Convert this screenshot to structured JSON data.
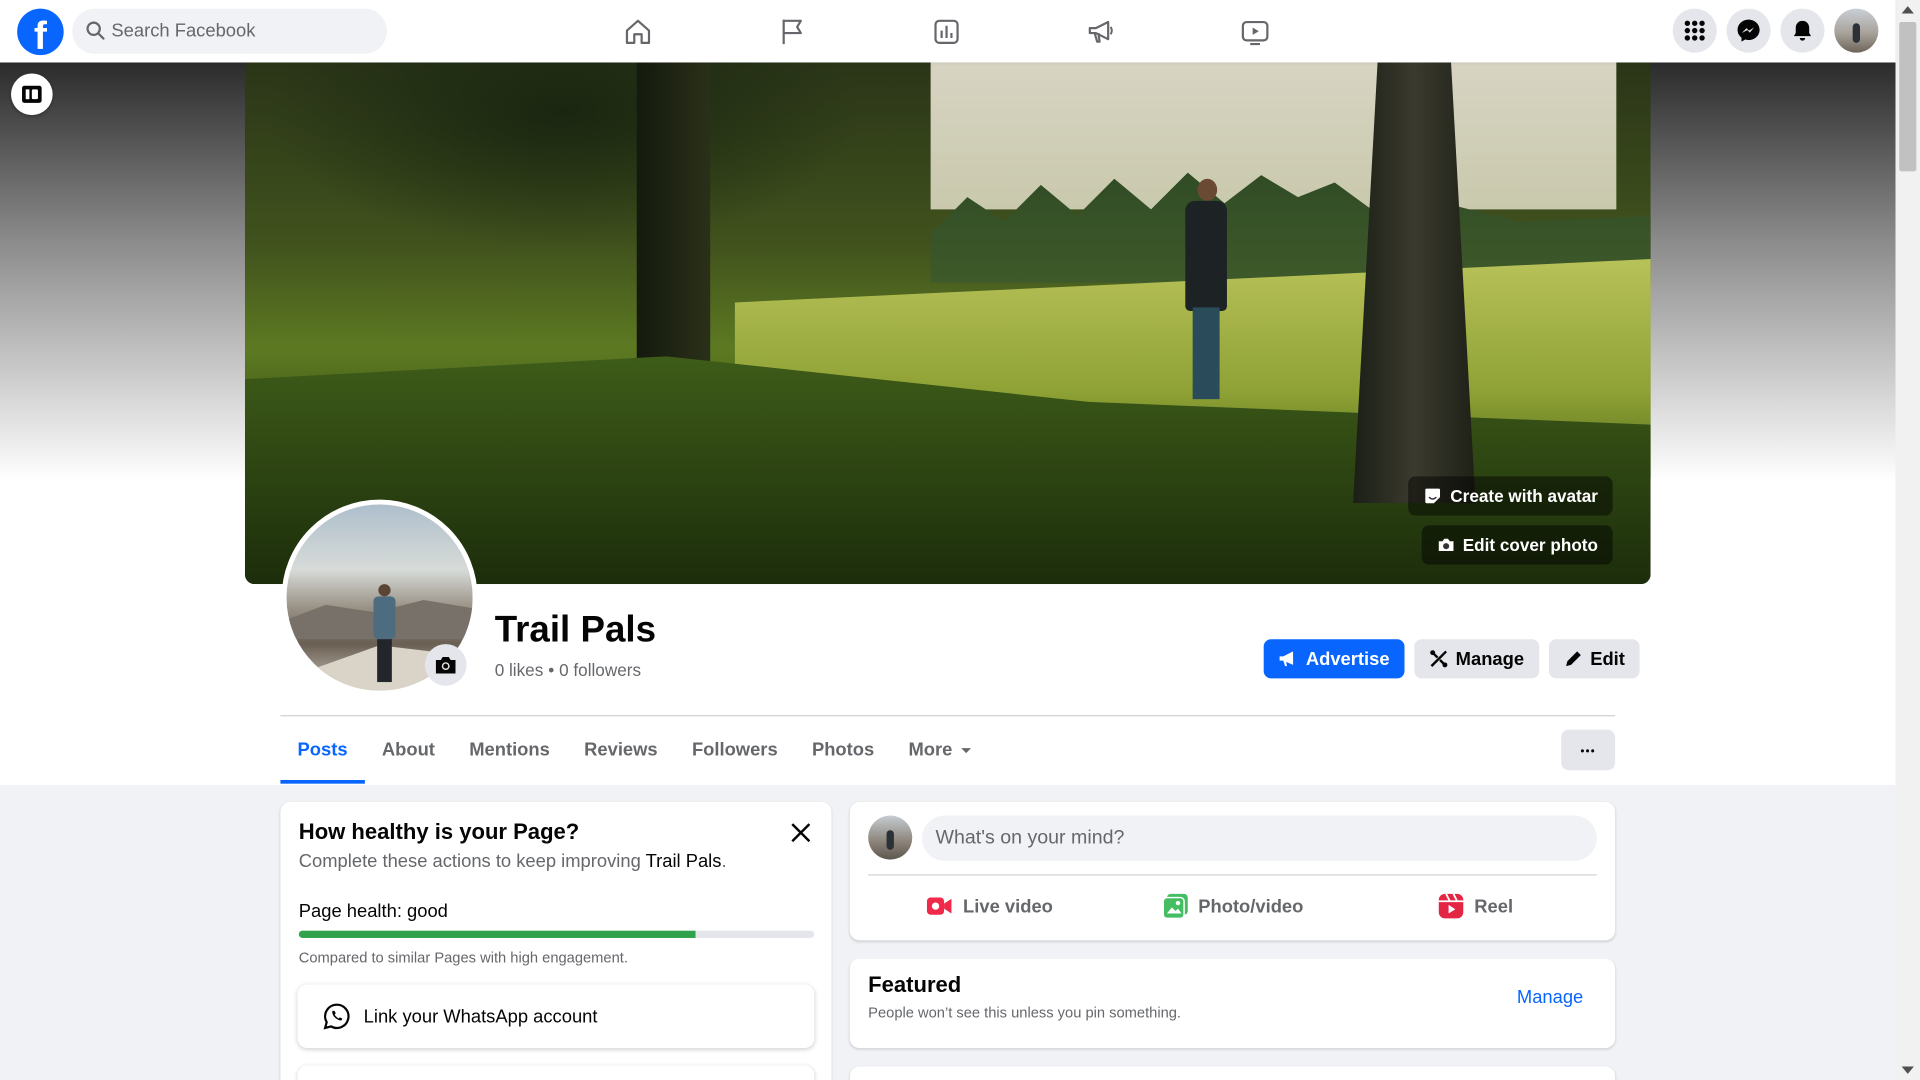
{
  "topbar": {
    "logo_letter": "f",
    "search_placeholder": "Search Facebook",
    "nav": [
      {
        "icon": "home-icon"
      },
      {
        "icon": "flag-icon"
      },
      {
        "icon": "insights-icon"
      },
      {
        "icon": "megaphone-icon"
      },
      {
        "icon": "video-icon"
      }
    ],
    "right": [
      {
        "icon": "menu-grid-icon"
      },
      {
        "icon": "messenger-icon"
      },
      {
        "icon": "notifications-bell-icon"
      }
    ]
  },
  "cover": {
    "create_avatar_label": "Create with avatar",
    "edit_cover_label": "Edit cover photo"
  },
  "page": {
    "name": "Trail Pals",
    "likes": "0 likes",
    "separator": "•",
    "followers": "0 followers"
  },
  "actions": {
    "advertise": "Advertise",
    "manage": "Manage",
    "edit": "Edit"
  },
  "tabs": [
    "Posts",
    "About",
    "Mentions",
    "Reviews",
    "Followers",
    "Photos",
    "More"
  ],
  "tabs_more_dots": "•••",
  "health": {
    "title": "How healthy is your Page?",
    "subtitle_prefix": "Complete these actions to keep improving ",
    "subtitle_page": "Trail Pals",
    "subtitle_suffix": ".",
    "label": "Page health: good",
    "progress_fraction": 0.77,
    "note": "Compared to similar Pages with high engagement.",
    "whatsapp_label": "Link your WhatsApp account"
  },
  "composer": {
    "placeholder": "What's on your mind?",
    "live": "Live video",
    "photo": "Photo/video",
    "reel": "Reel"
  },
  "featured": {
    "title": "Featured",
    "subtitle": "People won’t see this unless you pin something.",
    "manage": "Manage"
  },
  "colors": {
    "brand": "#0866ff",
    "health_good": "#31a24c",
    "live_red": "#f02849",
    "photo_green": "#45bd62",
    "reel_pink": "#e42645"
  }
}
